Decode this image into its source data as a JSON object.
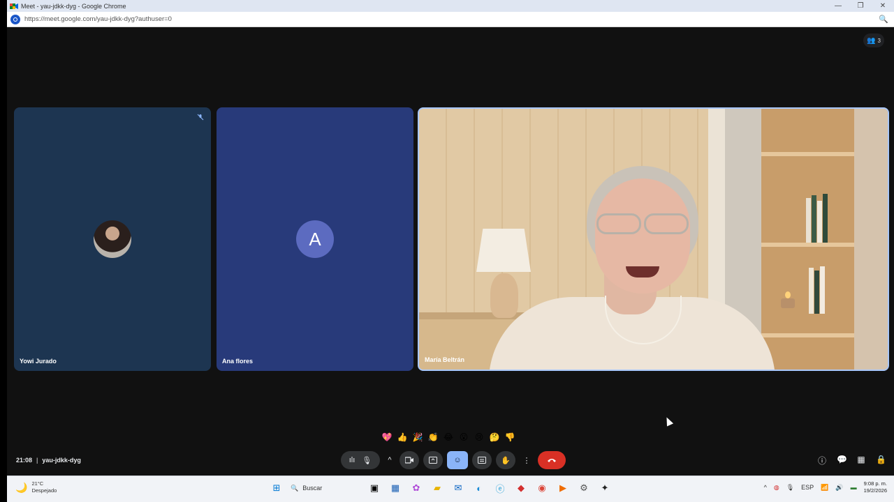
{
  "window": {
    "title": "Meet - yau-jdkk-dyg - Google Chrome",
    "url": "https://meet.google.com/yau-jdkk-dyg?authuser=0",
    "controls": [
      "—",
      "❐",
      "✕"
    ]
  },
  "meet": {
    "participant_count": "3",
    "participants": [
      {
        "name": "Yowi Jurado",
        "avatar": "photo",
        "muted": true
      },
      {
        "name": "Ana flores",
        "avatar_letter": "A"
      },
      {
        "name": "María Beltrán",
        "video": "on"
      }
    ],
    "reactions": [
      "💖",
      "👍",
      "🎉",
      "👏",
      "😂",
      "😮",
      "😢",
      "🤔",
      "👎"
    ],
    "time": "21:08",
    "meeting_code": "yau-jdkk-dyg",
    "colors": {
      "accent": "#8ab4f8",
      "hangup": "#d93025",
      "tile1": "#1d3551",
      "tile2": "#283a7a"
    }
  },
  "taskbar": {
    "weather_temp": "21°C",
    "weather_desc": "Despejado",
    "search_placeholder": "Buscar",
    "language": "ESP",
    "clock_time": "9:08 p. m.",
    "clock_date": "19/2/2026"
  }
}
